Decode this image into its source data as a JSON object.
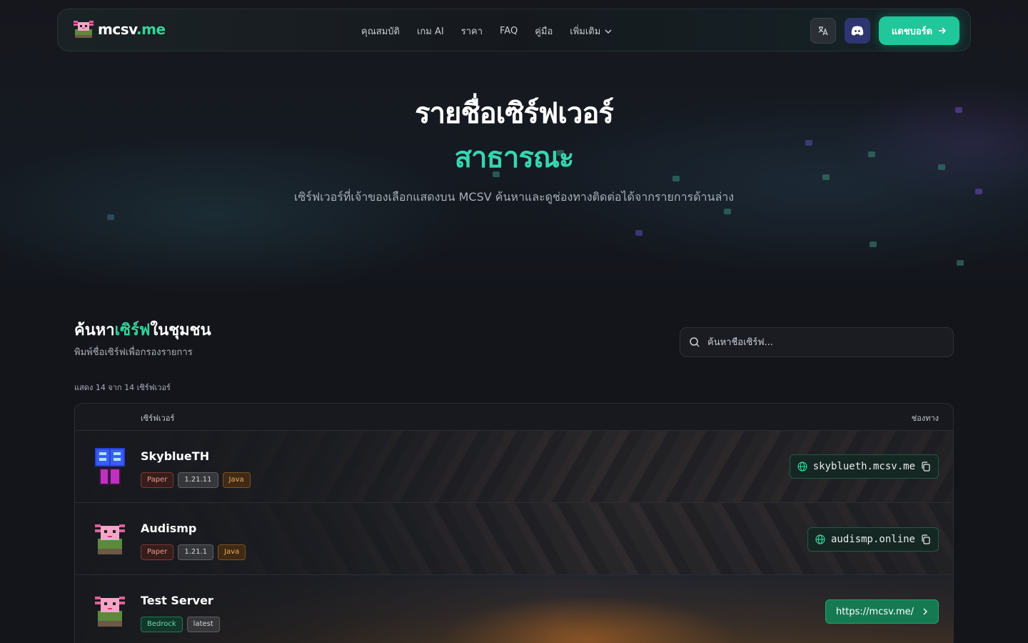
{
  "navbar": {
    "brand_name": "mcsv",
    "brand_tld": ".me",
    "links": [
      "คุณสมบัติ",
      "เกม AI",
      "ราคา",
      "FAQ",
      "คู่มือ"
    ],
    "more_label": "เพิ่มเติม",
    "dashboard_label": "แดชบอร์ด",
    "accent_color": "#1fc79a"
  },
  "hero": {
    "title": "รายชื่อเซิร์ฟเวอร์",
    "accent": "สาธารณะ",
    "description": "เซิร์ฟเวอร์ที่เจ้าของเลือกแสดงบน MCSV ค้นหาและดูช่องทางติดต่อได้จากรายการด้านล่าง"
  },
  "search_section": {
    "title_before": "ค้นหา",
    "title_highlight": "เซิร์ฟ",
    "title_after": "ในชุมชน",
    "subtitle": "พิมพ์ชื่อเซิร์ฟเพื่อกรองรายการ",
    "search_placeholder": "ค้นหาชื่อเซิร์ฟ...",
    "count_text": "แสดง 14 จาก 14 เซิร์ฟเวอร์"
  },
  "table": {
    "col_server": "เซิร์ฟเวอร์",
    "col_channel": "ช่องทาง",
    "rows": [
      {
        "name": "SkyblueTH",
        "badges": [
          "Paper",
          "1.21.11",
          "Java"
        ],
        "address": "skyblueth.mcsv.me"
      },
      {
        "name": "Audismp",
        "badges": [
          "Paper",
          "1.21.1",
          "Java"
        ],
        "address": "audismp.online"
      },
      {
        "name": "Test Server",
        "badges": [
          "Bedrock",
          "latest"
        ],
        "link": "https://mcsv.me/"
      }
    ]
  }
}
